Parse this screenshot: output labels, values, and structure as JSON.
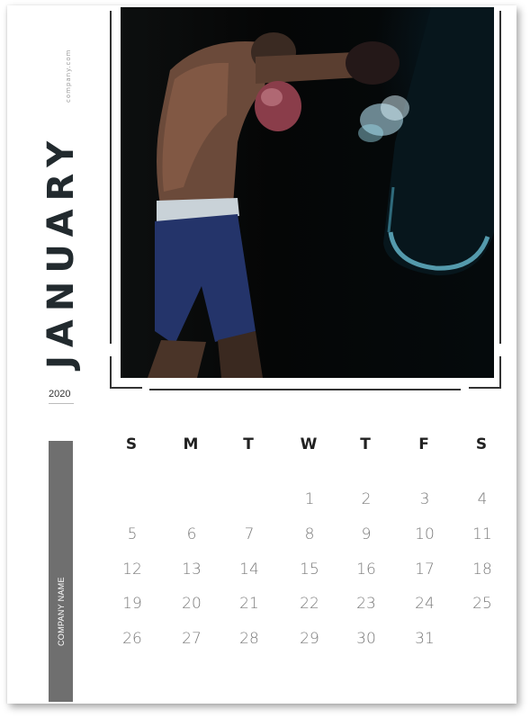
{
  "calendar": {
    "website": "company.com",
    "month": "JANUARY",
    "year": "2020",
    "company_name": "COMPANY NAME",
    "weekdays": [
      "S",
      "M",
      "T",
      "W",
      "T",
      "F",
      "S"
    ],
    "weeks": [
      [
        "",
        "",
        "",
        "1",
        "2",
        "3",
        "4"
      ],
      [
        "5",
        "6",
        "7",
        "8",
        "9",
        "10",
        "11"
      ],
      [
        "12",
        "13",
        "14",
        "15",
        "16",
        "17",
        "18"
      ],
      [
        "19",
        "20",
        "21",
        "22",
        "23",
        "24",
        "25"
      ],
      [
        "26",
        "27",
        "28",
        "29",
        "30",
        "31",
        ""
      ]
    ]
  },
  "colors": {
    "sidebar": "#6f6f6f",
    "month_text": "#222a2e",
    "day_text": "#7a7a7a"
  }
}
